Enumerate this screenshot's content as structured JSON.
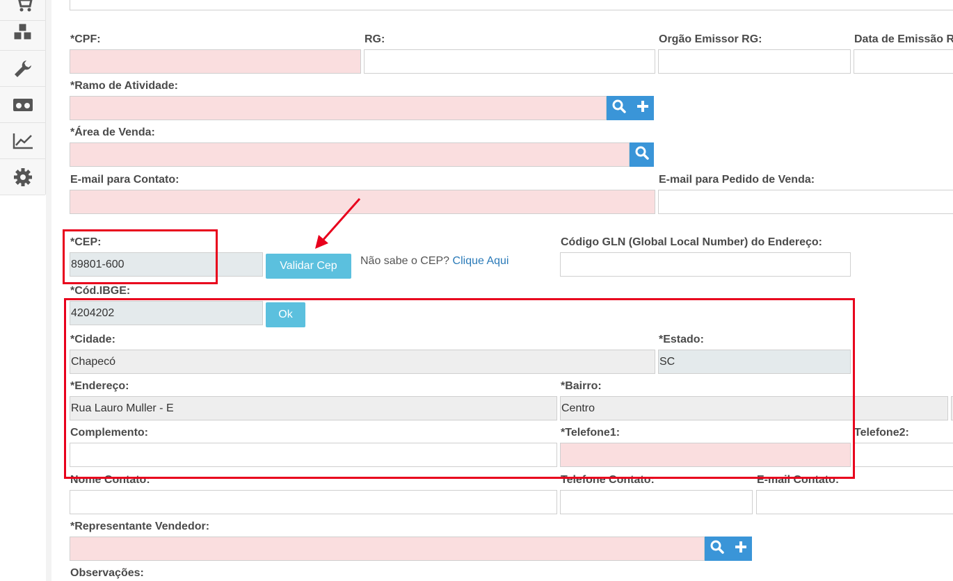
{
  "sidebar": {
    "items": [
      {
        "icon": "cart-icon"
      },
      {
        "icon": "boxes-icon"
      },
      {
        "icon": "wrench-icon"
      },
      {
        "icon": "binoculars-icon"
      },
      {
        "icon": "chart-icon"
      },
      {
        "icon": "gear-icon"
      }
    ]
  },
  "form": {
    "cpf_label": "*CPF:",
    "rg_label": "RG:",
    "orgao_label": "Orgão Emissor RG:",
    "data_emissao_label": "Data de Emissão R",
    "ramo_label": "*Ramo de Atividade:",
    "area_label": "*Área de Venda:",
    "email_contato_label": "E-mail para Contato:",
    "email_pedido_label": "E-mail para Pedido de Venda:",
    "cep_label": "*CEP:",
    "cep_value": "89801-600",
    "validar_cep_label": "Validar Cep",
    "cep_hint": "Não sabe o CEP?",
    "cep_link": "Clique Aqui",
    "gln_label": "Código GLN (Global Local Number) do Endereço:",
    "ibge_label": "*Cód.IBGE:",
    "ibge_value": "4204202",
    "ok_label": "Ok",
    "cidade_label": "*Cidade:",
    "cidade_value": "Chapecó",
    "estado_label": "*Estado:",
    "estado_value": "SC",
    "endereco_label": "*Endereço:",
    "endereco_value": "Rua Lauro Muller - E",
    "bairro_label": "*Bairro:",
    "bairro_value": "Centro",
    "complemento_label": "Complemento:",
    "telefone1_label": "*Telefone1:",
    "telefone2_label": "Telefone2:",
    "nome_contato_label": "Nome Contato:",
    "telefone_contato_label": "Telefone Contato:",
    "email_contato2_label": "E-mail Contato:",
    "representante_label": "*Representante Vendedor:",
    "observacoes_label": "Observações:"
  },
  "colors": {
    "required_field": "#fadedf",
    "addon_button": "#3a95d8",
    "info_button": "#5bc0de",
    "annotation": "#e8001c"
  }
}
